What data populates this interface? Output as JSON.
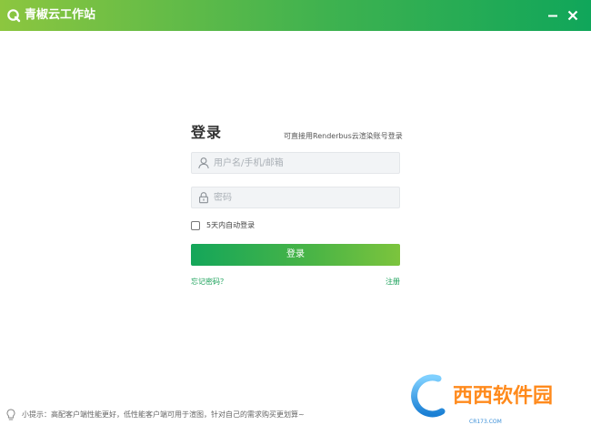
{
  "window": {
    "title": "青椒云工作站",
    "logo_icon": "app-logo-icon",
    "minimize_icon": "minimize-icon",
    "close_icon": "close-icon"
  },
  "login": {
    "title": "登录",
    "alt_login_link": "可直接用Renderbus云渲染账号登录",
    "username": {
      "value": "",
      "placeholder": "用户名/手机/邮箱",
      "icon": "user-icon"
    },
    "password": {
      "value": "",
      "placeholder": "密码",
      "icon": "lock-icon"
    },
    "remember_label": "5天内自动登录",
    "remember_checked": false,
    "submit_label": "登录",
    "forgot_label": "忘记密码？",
    "register_label": "注册"
  },
  "footer": {
    "tip_icon": "lightbulb-icon",
    "tip_text": "小提示：高配客户端性能更好，低性能客户端可用于渲图，针对自己的需求购买更划算~"
  },
  "watermark": {
    "text": "西西软件园",
    "subtext": "CR173.COM"
  },
  "colors": {
    "brand_green": "#18a058",
    "title_gradient_start": "#8cc63f",
    "title_gradient_end": "#10a65a"
  }
}
